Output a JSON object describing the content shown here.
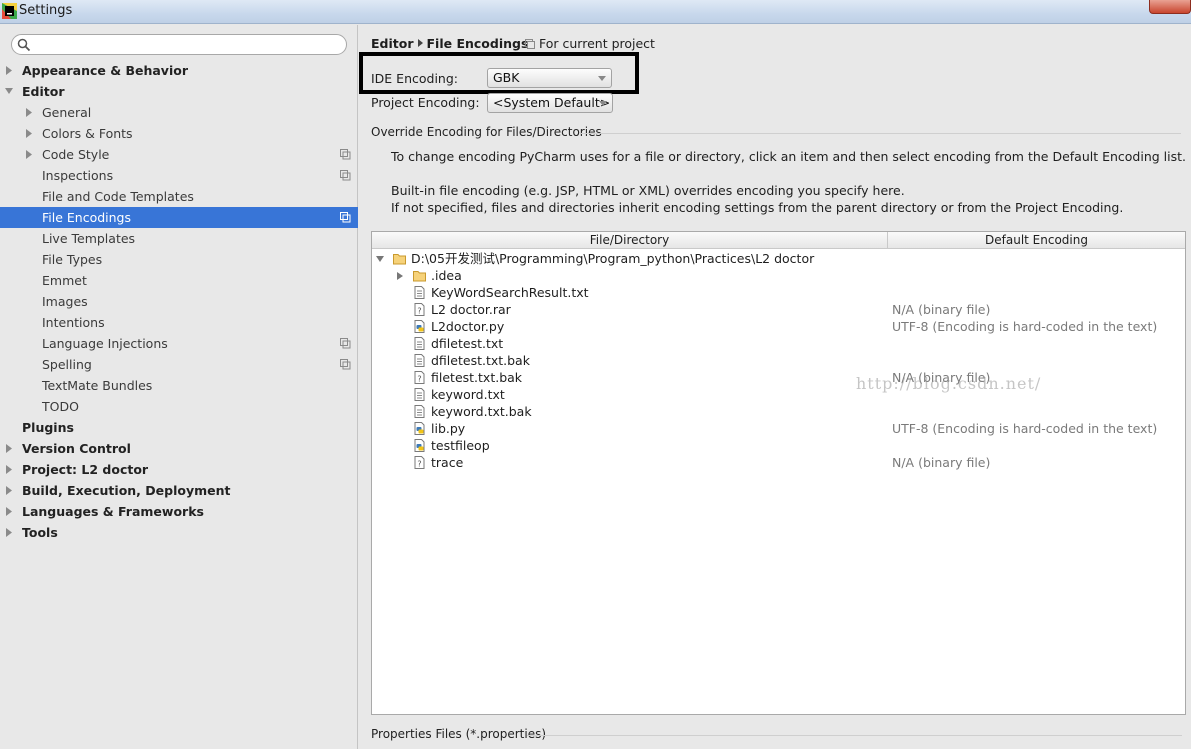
{
  "window": {
    "title": "Settings"
  },
  "search": {
    "placeholder": ""
  },
  "sidebar": {
    "items": [
      {
        "label": "Appearance & Behavior",
        "level": 0,
        "arrow": "right"
      },
      {
        "label": "Editor",
        "level": 0,
        "arrow": "down"
      },
      {
        "label": "General",
        "level": 1,
        "arrow": "right"
      },
      {
        "label": "Colors & Fonts",
        "level": 1,
        "arrow": "right"
      },
      {
        "label": "Code Style",
        "level": 1,
        "arrow": "right",
        "project": true
      },
      {
        "label": "Inspections",
        "level": 1,
        "project": true
      },
      {
        "label": "File and Code Templates",
        "level": 1
      },
      {
        "label": "File Encodings",
        "level": 1,
        "project": true,
        "selected": true
      },
      {
        "label": "Live Templates",
        "level": 1
      },
      {
        "label": "File Types",
        "level": 1
      },
      {
        "label": "Emmet",
        "level": 1
      },
      {
        "label": "Images",
        "level": 1
      },
      {
        "label": "Intentions",
        "level": 1
      },
      {
        "label": "Language Injections",
        "level": 1,
        "project": true
      },
      {
        "label": "Spelling",
        "level": 1,
        "project": true
      },
      {
        "label": "TextMate Bundles",
        "level": 1
      },
      {
        "label": "TODO",
        "level": 1
      },
      {
        "label": "Plugins",
        "level": 0
      },
      {
        "label": "Version Control",
        "level": 0,
        "arrow": "right"
      },
      {
        "label": "Project: L2 doctor",
        "level": 0,
        "arrow": "right"
      },
      {
        "label": "Build, Execution, Deployment",
        "level": 0,
        "arrow": "right"
      },
      {
        "label": "Languages & Frameworks",
        "level": 0,
        "arrow": "right"
      },
      {
        "label": "Tools",
        "level": 0,
        "arrow": "right"
      }
    ]
  },
  "breadcrumb": {
    "parent": "Editor",
    "current": "File Encodings",
    "scope": "For current project"
  },
  "ide_encoding": {
    "label": "IDE Encoding:",
    "value": "GBK"
  },
  "project_encoding": {
    "label": "Project Encoding:",
    "value": "<System Default>"
  },
  "override": {
    "section_title": "Override Encoding for Files/Directories",
    "desc1": "To change encoding PyCharm uses for a file or directory, click an item and then select encoding from the Default Encoding list.",
    "desc2": "Built-in file encoding (e.g. JSP, HTML or XML) overrides encoding you specify here.",
    "desc3": "If not specified, files and directories inherit encoding settings from the parent directory or from the Project Encoding."
  },
  "table": {
    "col1": "File/Directory",
    "col2": "Default Encoding",
    "rows": [
      {
        "name": "D:\\05开发测试\\Programming\\Program_python\\Practices\\L2 doctor",
        "type": "folder",
        "depth": 0,
        "arrow": "down",
        "encoding": ""
      },
      {
        "name": ".idea",
        "type": "folder",
        "depth": 1,
        "arrow": "right",
        "encoding": ""
      },
      {
        "name": "KeyWordSearchResult.txt",
        "type": "text",
        "depth": 1,
        "encoding": ""
      },
      {
        "name": "L2 doctor.rar",
        "type": "unknown",
        "depth": 1,
        "encoding": "N/A (binary file)"
      },
      {
        "name": "L2doctor.py",
        "type": "python",
        "depth": 1,
        "encoding": "UTF-8 (Encoding is hard-coded in the text)"
      },
      {
        "name": "dfiletest.txt",
        "type": "text",
        "depth": 1,
        "encoding": ""
      },
      {
        "name": "dfiletest.txt.bak",
        "type": "text",
        "depth": 1,
        "encoding": ""
      },
      {
        "name": "filetest.txt.bak",
        "type": "unknown",
        "depth": 1,
        "encoding": "N/A (binary file)"
      },
      {
        "name": "keyword.txt",
        "type": "text",
        "depth": 1,
        "encoding": ""
      },
      {
        "name": "keyword.txt.bak",
        "type": "text",
        "depth": 1,
        "encoding": ""
      },
      {
        "name": "lib.py",
        "type": "python",
        "depth": 1,
        "encoding": "UTF-8 (Encoding is hard-coded in the text)"
      },
      {
        "name": "testfileop",
        "type": "python",
        "depth": 1,
        "encoding": ""
      },
      {
        "name": "trace",
        "type": "unknown",
        "depth": 1,
        "encoding": "N/A (binary file)"
      }
    ]
  },
  "watermark": "http://blog.csdn.net/",
  "properties": {
    "section_title": "Properties Files (*.properties)"
  },
  "colors": {
    "selection": "#3875d7",
    "folder": "#e8b44a",
    "background": "#e8e8e8"
  }
}
